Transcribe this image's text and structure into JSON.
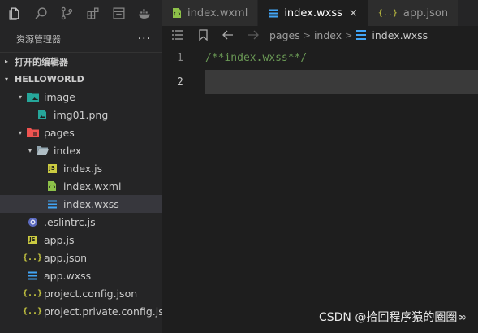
{
  "activity_bar": {
    "icons": [
      "files-icon",
      "search-icon",
      "source-control-icon",
      "extensions-icon",
      "preview-icon",
      "docker-icon"
    ]
  },
  "explorer": {
    "title": "资源管理器",
    "more": "···",
    "open_editors": "打开的编辑器",
    "project": "HELLOWORLD",
    "tree": [
      {
        "label": "image",
        "kind": "folder-image",
        "depth": 1,
        "chevron": "▾"
      },
      {
        "label": "img01.png",
        "kind": "png",
        "depth": 2,
        "chevron": ""
      },
      {
        "label": "pages",
        "kind": "folder-pages",
        "depth": 1,
        "chevron": "▾"
      },
      {
        "label": "index",
        "kind": "folder",
        "depth": 2,
        "chevron": "▾"
      },
      {
        "label": "index.js",
        "kind": "js",
        "depth": 3,
        "chevron": ""
      },
      {
        "label": "index.wxml",
        "kind": "wxml",
        "depth": 3,
        "chevron": ""
      },
      {
        "label": "index.wxss",
        "kind": "wxss",
        "depth": 3,
        "chevron": "",
        "selected": true
      },
      {
        "label": ".eslintrc.js",
        "kind": "eslint",
        "depth": 1,
        "chevron": ""
      },
      {
        "label": "app.js",
        "kind": "js",
        "depth": 1,
        "chevron": ""
      },
      {
        "label": "app.json",
        "kind": "json",
        "depth": 1,
        "chevron": ""
      },
      {
        "label": "app.wxss",
        "kind": "wxss",
        "depth": 1,
        "chevron": ""
      },
      {
        "label": "project.config.json",
        "kind": "json",
        "depth": 1,
        "chevron": ""
      },
      {
        "label": "project.private.config.js...",
        "kind": "json",
        "depth": 1,
        "chevron": ""
      }
    ]
  },
  "tabs": [
    {
      "label": "index.wxml",
      "kind": "wxml",
      "active": false
    },
    {
      "label": "index.wxss",
      "kind": "wxss",
      "active": true,
      "close": "×"
    },
    {
      "label": "app.json",
      "kind": "json",
      "active": false
    }
  ],
  "breadcrumb": {
    "parts": [
      "pages",
      "index"
    ],
    "separator": ">",
    "current": "index.wxss"
  },
  "editor": {
    "lines": [
      {
        "num": "1",
        "text": "/**index.wxss**/"
      },
      {
        "num": "2",
        "text": "",
        "current": true
      }
    ]
  },
  "watermark": "CSDN @拾回程序猿的圈圈∞",
  "colors": {
    "js": "#cbcb41",
    "json": "#cbcb41",
    "wxss": "#42a5f5",
    "wxml": "#8dc149",
    "comment": "#6a9955",
    "pages_folder": "#ef5350",
    "image_folder": "#26a69a"
  }
}
